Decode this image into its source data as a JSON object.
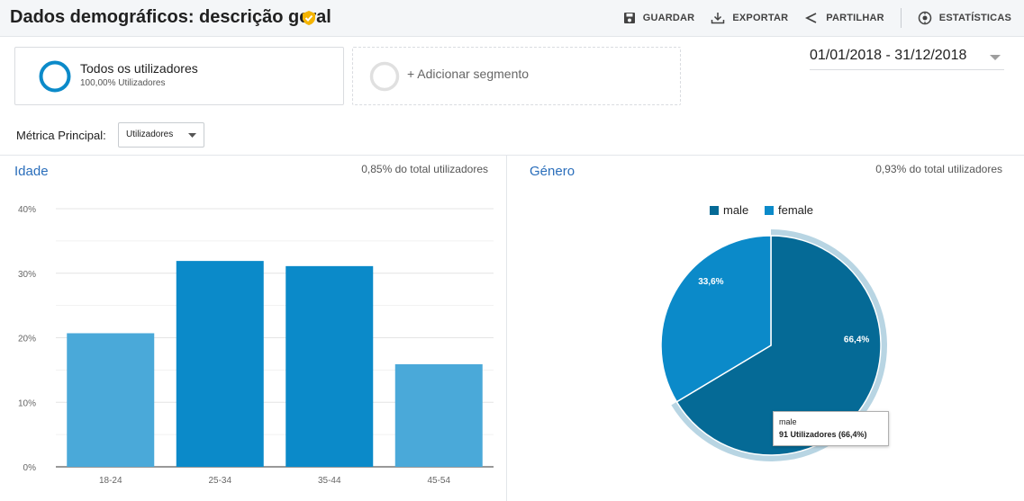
{
  "header": {
    "title": "Dados demográficos: descrição geral",
    "actions": {
      "save": "GUARDAR",
      "export": "EXPORTAR",
      "share": "PARTILHAR",
      "insights": "ESTATÍSTICAS"
    }
  },
  "segments": {
    "active": {
      "title": "Todos os utilizadores",
      "subtitle": "100,00% Utilizadores"
    },
    "add_label": "+ Adicionar segmento"
  },
  "date_range": "01/01/2018 - 31/12/2018",
  "metric": {
    "label": "Métrica Principal:",
    "selected": "Utilizadores"
  },
  "colors": {
    "accent": "#2a6ebb",
    "bar_light": "#4aa9d9",
    "bar_dark": "#0b8ac9",
    "pie_male": "#056a96",
    "pie_female": "#0b8ac9",
    "pie_highlight": "#b8d5e3"
  },
  "age_panel": {
    "title": "Idade",
    "note": "0,85% do total utilizadores"
  },
  "gender_panel": {
    "title": "Género",
    "note": "0,93% do total utilizadores"
  },
  "tooltip": {
    "label": "male",
    "value": "91 Utilizadores (66,4%)"
  },
  "chart_data": [
    {
      "type": "bar",
      "title": "Idade",
      "categories": [
        "18-24",
        "25-34",
        "35-44",
        "45-54"
      ],
      "values": [
        20.7,
        31.9,
        31.1,
        15.9
      ],
      "y_ticks": [
        "0%",
        "10%",
        "20%",
        "30%",
        "40%"
      ],
      "ylim": [
        0,
        40
      ],
      "grid": true
    },
    {
      "type": "pie",
      "title": "Género",
      "categories": [
        "male",
        "female"
      ],
      "values": [
        66.4,
        33.6
      ],
      "slice_labels": [
        "66,4%",
        "33,6%"
      ],
      "legend": "top",
      "highlighted": "male"
    }
  ]
}
